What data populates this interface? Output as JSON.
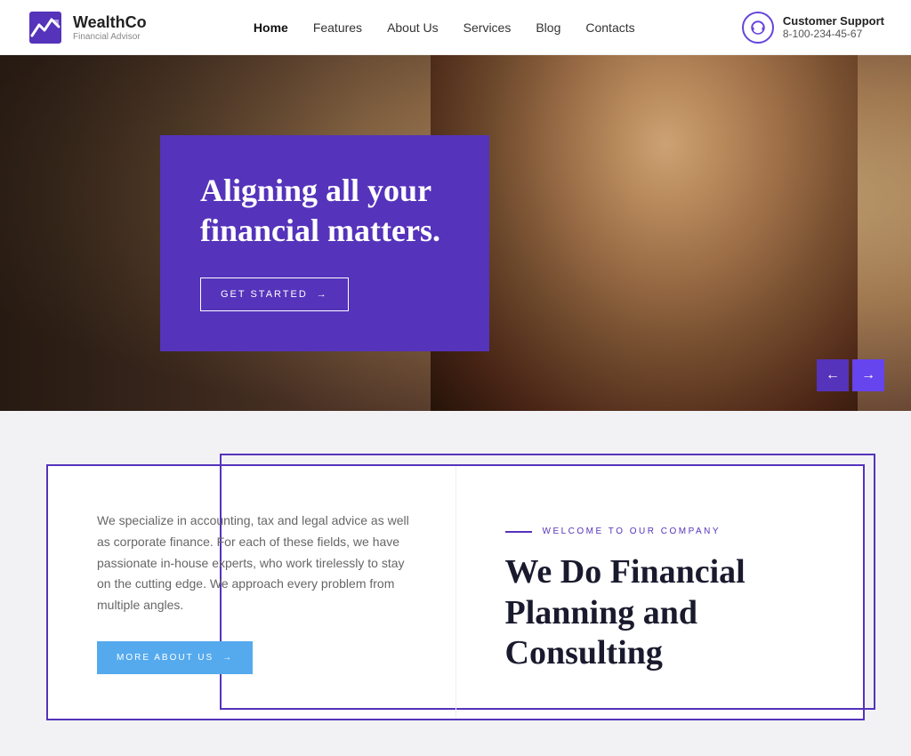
{
  "header": {
    "logo_name": "WealthCo",
    "logo_tagline": "Financial Advisor",
    "nav_items": [
      {
        "label": "Home",
        "active": true
      },
      {
        "label": "Features",
        "active": false
      },
      {
        "label": "About Us",
        "active": false
      },
      {
        "label": "Services",
        "active": false
      },
      {
        "label": "Blog",
        "active": false
      },
      {
        "label": "Contacts",
        "active": false
      }
    ],
    "support_label": "Customer Support",
    "support_number": "8-100-234-45-67"
  },
  "hero": {
    "title": "Aligning all your financial matters.",
    "cta_label": "GET STARTED",
    "arrow": "→",
    "prev_arrow": "←",
    "next_arrow": "→"
  },
  "info_section": {
    "description": "We specialize in accounting, tax and legal advice as well as corporate finance. For each of these fields, we have passionate in-house experts, who work tirelessly to stay on the cutting edge. We approach every problem from multiple angles.",
    "more_btn_label": "MORE ABOUT US",
    "more_btn_arrow": "→",
    "welcome_label": "WELCOME TO OUR COMPANY",
    "right_title": "We Do Financial Planning and Consulting"
  }
}
